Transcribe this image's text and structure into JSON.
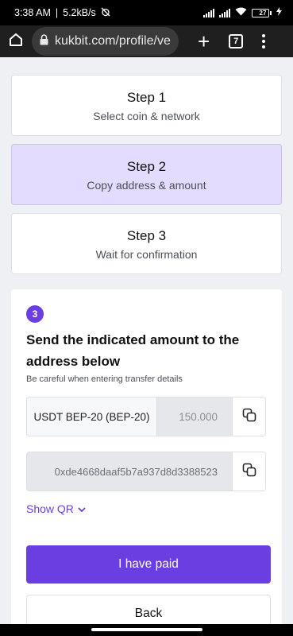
{
  "status_bar": {
    "time": "3:38 AM",
    "speed": "5.2kB/s",
    "battery": "27"
  },
  "browser": {
    "url": "kukbit.com/profile/ve",
    "tab_count": "7"
  },
  "steps": [
    {
      "title": "Step 1",
      "subtitle": "Select coin & network"
    },
    {
      "title": "Step 2",
      "subtitle": "Copy address & amount"
    },
    {
      "title": "Step 3",
      "subtitle": "Wait for confirmation"
    }
  ],
  "payment": {
    "step_number": "3",
    "heading": "Send the indicated amount to the address below",
    "caution": "Be careful when entering transfer details",
    "coin": "USDT BEP-20 (BEP-20)",
    "amount": "150.000",
    "address": "0xde4668daaf5b7a937d8d3388523",
    "show_qr": "Show QR",
    "paid_button": "I have paid",
    "back_button": "Back"
  },
  "colors": {
    "accent": "#6a3ee0",
    "active_step_bg": "#e4dcff",
    "page_bg": "#eef0f3"
  }
}
